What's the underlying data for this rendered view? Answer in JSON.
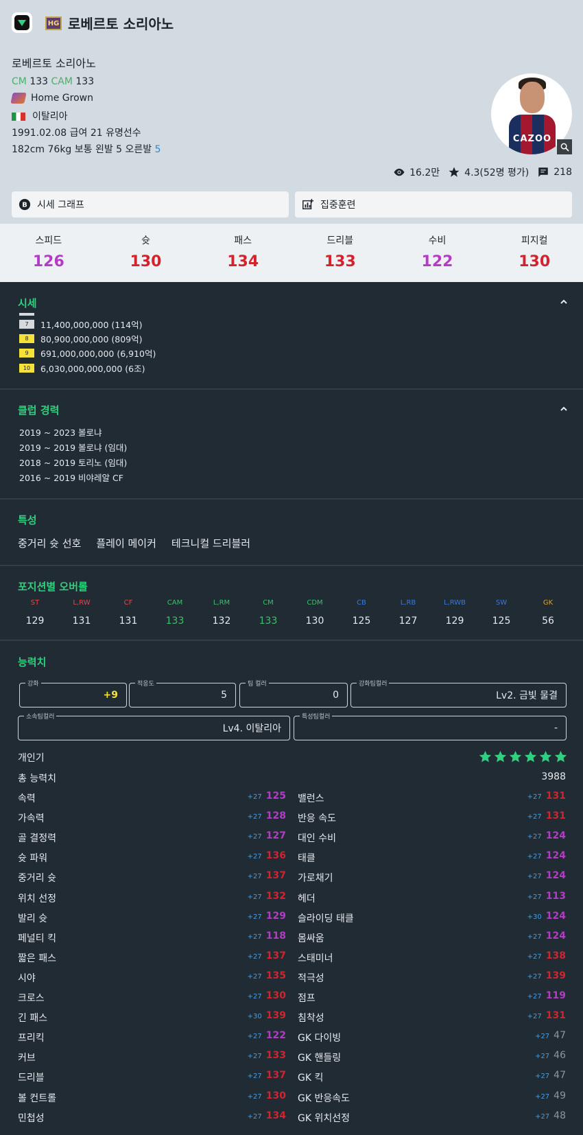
{
  "header": {
    "title": "로베르토 소리아노",
    "badge_text": "HG"
  },
  "profile": {
    "name": "로베르토 소리아노",
    "positions": [
      {
        "pos": "CM",
        "ovr": "133"
      },
      {
        "pos": "CAM",
        "ovr": "133"
      }
    ],
    "trait_team": "Home Grown",
    "nation": "이탈리아",
    "info_line": "1991.02.08  급여 21  유명선수",
    "body_line": "182cm 76kg  보통  왼발 5 오른발",
    "right_foot": "5",
    "photo_sponsor": "CAZOO"
  },
  "meta": {
    "views": "16.2만",
    "rating": "4.3(52명 평가)",
    "comments": "218"
  },
  "buttons": {
    "price_graph": "시세 그래프",
    "training": "집중훈련"
  },
  "overview": [
    {
      "label": "스피드",
      "value": "126",
      "color": "#b53bc7"
    },
    {
      "label": "슛",
      "value": "130",
      "color": "#d2232f"
    },
    {
      "label": "패스",
      "value": "134",
      "color": "#d2232f"
    },
    {
      "label": "드리블",
      "value": "133",
      "color": "#d2232f"
    },
    {
      "label": "수비",
      "value": "122",
      "color": "#b53bc7"
    },
    {
      "label": "피지컬",
      "value": "130",
      "color": "#d2232f"
    }
  ],
  "price": {
    "title": "시세",
    "rows": [
      {
        "level": "7",
        "value": "11,400,000,000 (114억)",
        "color": "#d6d9dc"
      },
      {
        "level": "8",
        "value": "80,900,000,000 (809억)",
        "color": "#f4e23b"
      },
      {
        "level": "9",
        "value": "691,000,000,000 (6,910억)",
        "color": "#f4e23b"
      },
      {
        "level": "10",
        "value": "6,030,000,000,000 (6조)",
        "color": "#f4e23b"
      }
    ]
  },
  "club": {
    "title": "클럽 경력",
    "items": [
      "2019 ~ 2023 볼로냐",
      "2019 ~ 2019 볼로냐 (임대)",
      "2018 ~ 2019 토리노 (임대)",
      "2016 ~ 2019 비야레알 CF"
    ]
  },
  "traits": {
    "title": "특성",
    "items": [
      "중거리 슛 선호",
      "플레이 메이커",
      "테크니컬 드리블러"
    ]
  },
  "position_ovr": {
    "title": "포지션별 오버롤",
    "items": [
      {
        "pos": "ST",
        "value": "129",
        "color": "#e04a4a"
      },
      {
        "pos": "L,RW",
        "value": "131",
        "color": "#e04a4a"
      },
      {
        "pos": "CF",
        "value": "131",
        "color": "#e04a4a"
      },
      {
        "pos": "CAM",
        "value": "133",
        "color": "#3fbf6a",
        "hl": true
      },
      {
        "pos": "L,RM",
        "value": "132",
        "color": "#3fbf6a"
      },
      {
        "pos": "CM",
        "value": "133",
        "color": "#3fbf6a",
        "hl": true
      },
      {
        "pos": "CDM",
        "value": "130",
        "color": "#3fbf6a"
      },
      {
        "pos": "CB",
        "value": "125",
        "color": "#3d78d6"
      },
      {
        "pos": "L,RB",
        "value": "127",
        "color": "#3d78d6"
      },
      {
        "pos": "L,RWB",
        "value": "129",
        "color": "#3d78d6"
      },
      {
        "pos": "SW",
        "value": "125",
        "color": "#3d78d6"
      },
      {
        "pos": "GK",
        "value": "56",
        "color": "#e0a030"
      }
    ]
  },
  "abilities": {
    "title": "능력치",
    "fields": [
      {
        "legend": "강화",
        "value": "+9",
        "value_color": "#f4e23b"
      },
      {
        "legend": "적응도",
        "value": "5"
      },
      {
        "legend": "팀 컬러",
        "value": "0"
      },
      {
        "legend": "강화팀컬러",
        "value": "Lv2. 금빛 물결"
      },
      {
        "legend": "소속팀컬러",
        "value": "Lv4. 이탈리아"
      },
      {
        "legend": "특성팀컬러",
        "value": "-"
      }
    ],
    "popularity_label": "개인기",
    "popularity_stars": 6,
    "total_label": "총 능력치",
    "total_value": "3988",
    "left": [
      {
        "name": "속력",
        "bonus": "+27",
        "value": "125",
        "color": "#b53bc7"
      },
      {
        "name": "가속력",
        "bonus": "+27",
        "value": "128",
        "color": "#b53bc7"
      },
      {
        "name": "골 결정력",
        "bonus": "+27",
        "value": "127",
        "color": "#b53bc7"
      },
      {
        "name": "슛 파워",
        "bonus": "+27",
        "value": "136",
        "color": "#d2232f"
      },
      {
        "name": "중거리 슛",
        "bonus": "+27",
        "value": "137",
        "color": "#d2232f"
      },
      {
        "name": "위치 선정",
        "bonus": "+27",
        "value": "132",
        "color": "#d2232f"
      },
      {
        "name": "발리 슛",
        "bonus": "+27",
        "value": "129",
        "color": "#b53bc7"
      },
      {
        "name": "페널티 킥",
        "bonus": "+27",
        "value": "118",
        "color": "#b53bc7"
      },
      {
        "name": "짧은 패스",
        "bonus": "+27",
        "value": "137",
        "color": "#d2232f"
      },
      {
        "name": "시야",
        "bonus": "+27",
        "value": "135",
        "color": "#d2232f"
      },
      {
        "name": "크로스",
        "bonus": "+27",
        "value": "130",
        "color": "#d2232f"
      },
      {
        "name": "긴 패스",
        "bonus": "+30",
        "value": "139",
        "color": "#d2232f"
      },
      {
        "name": "프리킥",
        "bonus": "+27",
        "value": "122",
        "color": "#b53bc7"
      },
      {
        "name": "커브",
        "bonus": "+27",
        "value": "133",
        "color": "#d2232f"
      },
      {
        "name": "드리블",
        "bonus": "+27",
        "value": "137",
        "color": "#d2232f"
      },
      {
        "name": "볼 컨트롤",
        "bonus": "+27",
        "value": "130",
        "color": "#d2232f"
      },
      {
        "name": "민첩성",
        "bonus": "+27",
        "value": "134",
        "color": "#d2232f"
      }
    ],
    "right": [
      {
        "name": "밸런스",
        "bonus": "+27",
        "value": "131",
        "color": "#d2232f"
      },
      {
        "name": "반응 속도",
        "bonus": "+27",
        "value": "131",
        "color": "#d2232f"
      },
      {
        "name": "대인 수비",
        "bonus": "+27",
        "value": "124",
        "color": "#b53bc7"
      },
      {
        "name": "태클",
        "bonus": "+27",
        "value": "124",
        "color": "#b53bc7"
      },
      {
        "name": "가로채기",
        "bonus": "+27",
        "value": "124",
        "color": "#b53bc7"
      },
      {
        "name": "헤더",
        "bonus": "+27",
        "value": "113",
        "color": "#b53bc7"
      },
      {
        "name": "슬라이딩 태클",
        "bonus": "+30",
        "value": "124",
        "color": "#b53bc7"
      },
      {
        "name": "몸싸움",
        "bonus": "+27",
        "value": "124",
        "color": "#b53bc7"
      },
      {
        "name": "스태미너",
        "bonus": "+27",
        "value": "138",
        "color": "#d2232f"
      },
      {
        "name": "적극성",
        "bonus": "+27",
        "value": "139",
        "color": "#d2232f"
      },
      {
        "name": "점프",
        "bonus": "+27",
        "value": "119",
        "color": "#b53bc7"
      },
      {
        "name": "침착성",
        "bonus": "+27",
        "value": "131",
        "color": "#d2232f"
      },
      {
        "name": "GK 다이빙",
        "bonus": "+27",
        "value": "47",
        "color": "#8d979f"
      },
      {
        "name": "GK 핸들링",
        "bonus": "+27",
        "value": "46",
        "color": "#8d979f"
      },
      {
        "name": "GK 킥",
        "bonus": "+27",
        "value": "47",
        "color": "#8d979f"
      },
      {
        "name": "GK 반응속도",
        "bonus": "+27",
        "value": "49",
        "color": "#8d979f"
      },
      {
        "name": "GK 위치선정",
        "bonus": "+27",
        "value": "48",
        "color": "#8d979f"
      }
    ]
  }
}
